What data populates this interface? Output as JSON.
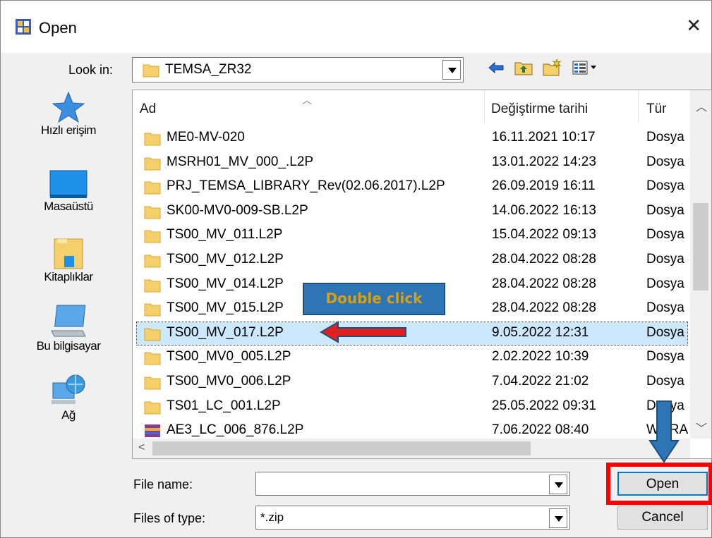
{
  "window": {
    "title": "Open"
  },
  "lookin": {
    "label": "Look in:",
    "value": "TEMSA_ZR32"
  },
  "places": [
    {
      "label": "Hızlı erişim",
      "icon": "star-icon"
    },
    {
      "label": "Masaüstü",
      "icon": "desktop-icon"
    },
    {
      "label": "Kitaplıklar",
      "icon": "libraries-icon"
    },
    {
      "label": "Bu bilgisayar",
      "icon": "computer-icon"
    },
    {
      "label": "Ağ",
      "icon": "network-icon"
    }
  ],
  "columns": {
    "name": "Ad",
    "date": "Değiştirme tarihi",
    "type": "Tür"
  },
  "files": [
    {
      "name": "ME0-MV-020",
      "date": "16.11.2021 10:17",
      "type": "Dosya"
    },
    {
      "name": "MSRH01_MV_000_.L2P",
      "date": "13.01.2022 14:23",
      "type": "Dosya"
    },
    {
      "name": "PRJ_TEMSA_LIBRARY_Rev(02.06.2017).L2P",
      "date": "26.09.2019 16:11",
      "type": "Dosya"
    },
    {
      "name": "SK00-MV0-009-SB.L2P",
      "date": "14.06.2022 16:13",
      "type": "Dosya"
    },
    {
      "name": "TS00_MV_011.L2P",
      "date": "15.04.2022 09:13",
      "type": "Dosya"
    },
    {
      "name": "TS00_MV_012.L2P",
      "date": "28.04.2022 08:28",
      "type": "Dosya"
    },
    {
      "name": "TS00_MV_014.L2P",
      "date": "28.04.2022 08:28",
      "type": "Dosya"
    },
    {
      "name": "TS00_MV_015.L2P",
      "date": "28.04.2022 08:28",
      "type": "Dosya"
    },
    {
      "name": "TS00_MV_017.L2P",
      "date": "9.05.2022 12:31",
      "type": "Dosya"
    },
    {
      "name": "TS00_MV0_005.L2P",
      "date": "2.02.2022 10:39",
      "type": "Dosya"
    },
    {
      "name": "TS00_MV0_006.L2P",
      "date": "7.04.2022 21:02",
      "type": "Dosya"
    },
    {
      "name": "TS01_LC_001.L2P",
      "date": "25.05.2022 09:31",
      "type": "Dosya"
    },
    {
      "name": "AE3_LC_006_876.L2P",
      "date": "7.06.2022 08:40",
      "type": "WinRA"
    }
  ],
  "selected_file": "TS00_MV_017.L2P",
  "filename": {
    "label": "File name:",
    "value": ""
  },
  "filetype": {
    "label": "Files of type:",
    "value": "*.zip"
  },
  "buttons": {
    "open": "Open",
    "cancel": "Cancel"
  },
  "annotation": {
    "text": "Double click"
  }
}
